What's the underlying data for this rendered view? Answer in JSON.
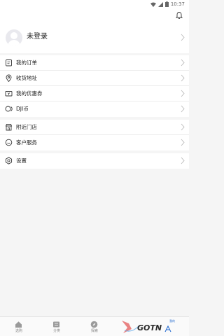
{
  "status_bar": {
    "time": "10:37"
  },
  "profile": {
    "name": "未登录"
  },
  "menu_group_1": [
    {
      "label": "我的订单",
      "icon": "order-icon"
    },
    {
      "label": "收货地址",
      "icon": "location-pin-icon"
    },
    {
      "label": "我的优惠券",
      "icon": "coupon-icon"
    },
    {
      "label": "DJI币",
      "icon": "coins-icon"
    }
  ],
  "menu_group_2": [
    {
      "label": "附近门店",
      "icon": "store-icon"
    },
    {
      "label": "客户服务",
      "icon": "service-smile-icon"
    }
  ],
  "menu_group_3": [
    {
      "label": "设置",
      "icon": "gear-icon"
    }
  ],
  "tabbar": {
    "tabs": [
      {
        "label": "选购",
        "icon": "home-icon"
      },
      {
        "label": "分类",
        "icon": "category-icon"
      },
      {
        "label": "探索",
        "icon": "compass-icon"
      },
      {
        "label": "",
        "icon": ""
      },
      {
        "label": "",
        "icon": "account-icon",
        "badge": "我的"
      }
    ]
  },
  "watermark": {
    "text": "GOTN"
  },
  "colors": {
    "accent": "#2a6fd1",
    "background": "#f5f5f5",
    "divider": "#ececec"
  }
}
